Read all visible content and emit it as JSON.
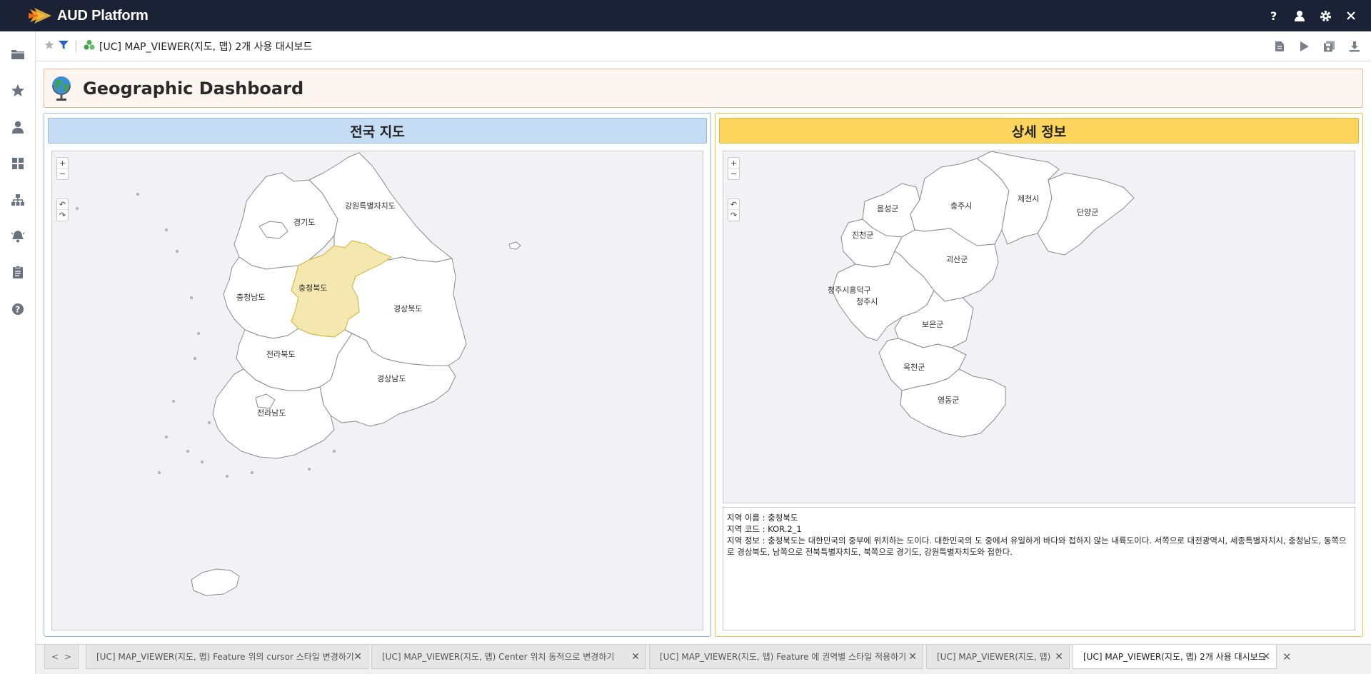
{
  "app": {
    "title": "AUD Platform"
  },
  "topbar_icons": [
    "help-icon",
    "user-icon",
    "settings-icon",
    "close-icon"
  ],
  "sidebar_icons": [
    "folder-icon",
    "star-icon",
    "person-icon",
    "dashboard-icon",
    "hierarchy-icon",
    "bell-icon",
    "clipboard-icon",
    "question-icon"
  ],
  "toolbar": {
    "report_title": "[UC] MAP_VIEWER(지도, 맵) 2개 사용 대시보드"
  },
  "dashboard": {
    "title": "Geographic Dashboard"
  },
  "left_panel": {
    "heading": "전국 지도",
    "regions": [
      "강원특별자치도",
      "경기도",
      "충청북도",
      "충청남도",
      "경상북도",
      "전라북도",
      "경상남도",
      "전라남도"
    ],
    "selected_region": "충청북도",
    "zoom_in": "+",
    "zoom_out": "−",
    "undo": "↶",
    "redo": "↷"
  },
  "right_panel": {
    "heading": "상세 정보",
    "districts": [
      "음성군",
      "충주시",
      "제천시",
      "단양군",
      "진천군",
      "괴산군",
      "청주시흥덕구",
      "청주시",
      "보은군",
      "옥천군",
      "영동군"
    ],
    "zoom_in": "+",
    "zoom_out": "−",
    "undo": "↶",
    "redo": "↷"
  },
  "info": {
    "name_line": "지역 이름 : 충청북도",
    "code_line": "지역 코드 : KOR.2_1",
    "desc_line": "지역 정보 : 충청북도는 대한민국의 중부에 위치하는 도이다. 대한민국의 도 중에서 유일하게 바다와 접하지 않는 내륙도이다. 서쪽으로 대전광역시, 세종특별자치시, 충청남도, 동쪽으로 경상북도, 남쪽으로 전북특별자치도, 북쪽으로 경기도, 강원특별자치도와 접한다."
  },
  "tabs": {
    "nav_prev": "<",
    "nav_next": ">",
    "items": [
      "[UC] MAP_VIEWER(지도, 맵) Feature 위의 cursor 스타일 변경하기",
      "[UC] MAP_VIEWER(지도, 맵) Center 위치 동적으로 변경하기",
      "[UC] MAP_VIEWER(지도, 맵) Feature 에 권역별 스타일 적용하기",
      "[UC] MAP_VIEWER(지도, 맵)",
      "[UC] MAP_VIEWER(지도, 맵) 2개 사용 대시보드"
    ],
    "close": "✕",
    "close_all": "✕"
  },
  "colors": {
    "topbar": "#1b2236",
    "selected_region": "#f4e7b0",
    "left_header": "#c5dcf5",
    "right_header": "#fcd45c"
  }
}
